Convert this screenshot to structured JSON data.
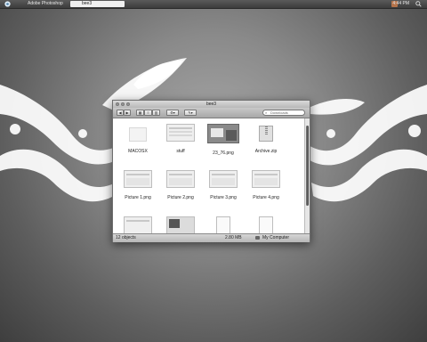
{
  "menubar": {
    "app_name": "Adobe Photoshop",
    "active_tab": "bee3",
    "clock": "4:44 PM"
  },
  "window": {
    "title": "bee3",
    "search_placeholder": "Downloads"
  },
  "files": [
    {
      "name": "MACOSX",
      "kind": "folder-icon"
    },
    {
      "name": "stuff",
      "kind": "screenshot"
    },
    {
      "name": "23_76.png",
      "kind": "photo"
    },
    {
      "name": "Archive.zip",
      "kind": "zip-icon"
    },
    {
      "name": "Picture 1.png",
      "kind": "screenshot"
    },
    {
      "name": "Picture 2.png",
      "kind": "screenshot"
    },
    {
      "name": "Picture 3.png",
      "kind": "screenshot"
    },
    {
      "name": "Picture 4.png",
      "kind": "screenshot"
    },
    {
      "name": "",
      "kind": "screenshot"
    },
    {
      "name": "",
      "kind": "screenshot"
    },
    {
      "name": "",
      "kind": "document"
    },
    {
      "name": "",
      "kind": "document"
    }
  ],
  "status": {
    "count": "12 objects",
    "size": "2.80 MB",
    "location": "My Computer"
  },
  "colors": {
    "wallpaper_light": "#a6a6a6",
    "wallpaper_dark": "#3e3e3e",
    "window_bg": "#f4f4f4"
  }
}
